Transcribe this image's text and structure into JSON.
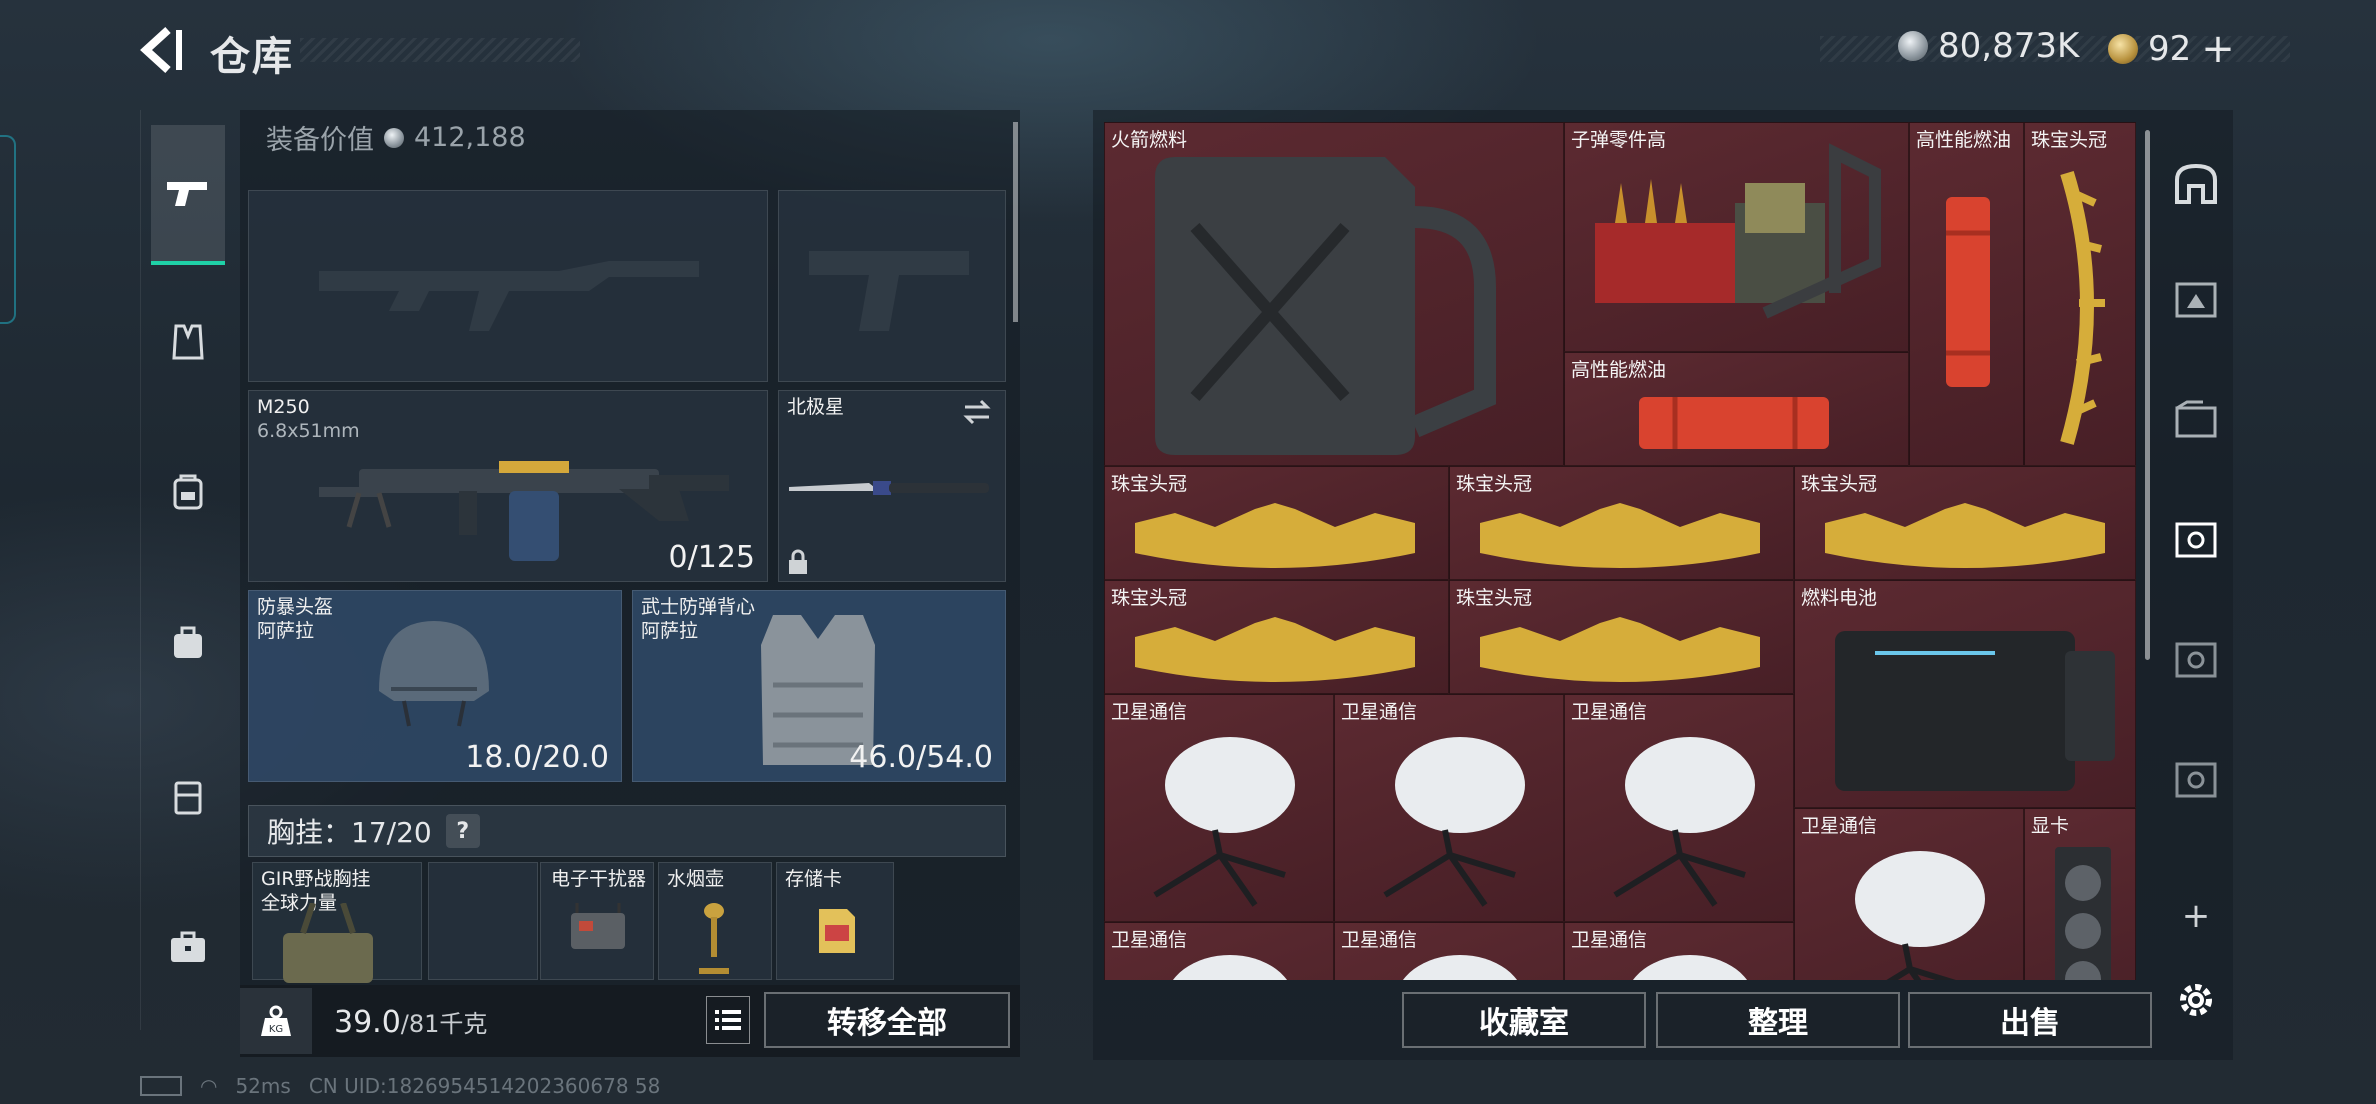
{
  "header": {
    "title": "仓库",
    "currency_silver": "80,873K",
    "currency_gold": "92"
  },
  "left": {
    "equip_value_label": "装备价值",
    "equip_value": "412,188",
    "primary": {
      "name": "M250",
      "ammo_type": "6.8x51mm",
      "ammo": "0/125"
    },
    "melee": {
      "name": "北极星"
    },
    "helmet": {
      "name": "防暴头盔",
      "faction": "阿萨拉",
      "durability": "18.0/20.0"
    },
    "armor": {
      "name": "武士防弹背心",
      "faction": "阿萨拉",
      "durability": "46.0/54.0"
    },
    "chest": {
      "label": "胸挂",
      "value": "17/20",
      "help": "?"
    },
    "rig": {
      "name": "GIR野战胸挂",
      "sub": "全球力量"
    },
    "rig_items": [
      "电子干扰器",
      "水烟壶",
      "存储卡"
    ],
    "weight_value": "39.0",
    "weight_max": "/81千克",
    "transfer_all": "转移全部"
  },
  "stash": {
    "cells": [
      {
        "label": "火箭燃料",
        "rarity": "red"
      },
      {
        "label": "子弹零件高",
        "rarity": "red"
      },
      {
        "label": "高性能燃油",
        "rarity": "red"
      },
      {
        "label": "珠宝头冠",
        "rarity": "red"
      },
      {
        "label": "高性能燃油",
        "rarity": "red"
      },
      {
        "label": "珠宝头冠",
        "rarity": "red"
      },
      {
        "label": "珠宝头冠",
        "rarity": "red"
      },
      {
        "label": "珠宝头冠",
        "rarity": "red"
      },
      {
        "label": "珠宝头冠",
        "rarity": "red"
      },
      {
        "label": "珠宝头冠",
        "rarity": "red"
      },
      {
        "label": "燃料电池",
        "rarity": "red"
      },
      {
        "label": "卫星通信",
        "rarity": "red"
      },
      {
        "label": "卫星通信",
        "rarity": "red"
      },
      {
        "label": "卫星通信",
        "rarity": "red"
      },
      {
        "label": "卫星通信",
        "rarity": "red"
      },
      {
        "label": "显卡",
        "rarity": "red"
      },
      {
        "label": "卫星通信",
        "rarity": "red"
      },
      {
        "label": "卫星通信",
        "rarity": "red"
      },
      {
        "label": "卫星通信",
        "rarity": "red"
      }
    ],
    "btn_collection": "收藏室",
    "btn_sort": "整理",
    "btn_sell": "出售",
    "add": "+"
  },
  "status": {
    "ping": "52ms",
    "uid": "CN UID:1826954514202360678 58"
  },
  "colors": {
    "accent": "#1fd1a7",
    "rarity_red": "#5c2a31"
  },
  "icons": [
    "back-arrow-icon",
    "silver-coin-icon",
    "gold-coin-icon",
    "gun-icon",
    "armor-vest-icon",
    "backpack-icon",
    "bag-icon",
    "chest-rig-icon",
    "case-icon",
    "weight-icon",
    "list-icon",
    "swap-icon",
    "lock-icon",
    "settings-icon"
  ]
}
